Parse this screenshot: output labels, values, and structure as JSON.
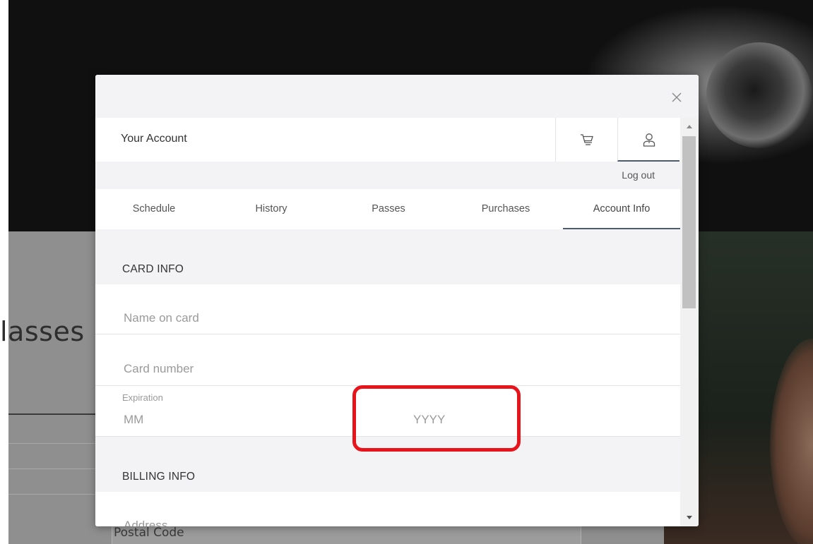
{
  "background": {
    "heading_fragment": "lasses",
    "field_label": "Postal Code"
  },
  "modal": {
    "close_icon": "close-icon",
    "header": {
      "title": "Your Account",
      "cart_icon": "cart-icon",
      "user_icon": "user-icon"
    },
    "logout_label": "Log out",
    "tabs": [
      {
        "label": "Schedule",
        "active": false
      },
      {
        "label": "History",
        "active": false
      },
      {
        "label": "Passes",
        "active": false
      },
      {
        "label": "Purchases",
        "active": false
      },
      {
        "label": "Account Info",
        "active": true
      }
    ],
    "card_info": {
      "heading": "CARD INFO",
      "name_placeholder": "Name on card",
      "number_placeholder": "Card number",
      "expiration_label": "Expiration",
      "month_placeholder": "MM",
      "year_placeholder": "YYYY"
    },
    "billing_info": {
      "heading": "BILLING INFO",
      "address_placeholder": "Address"
    }
  },
  "colors": {
    "accent_underline": "#4c5a72",
    "highlight": "#e8141b"
  }
}
